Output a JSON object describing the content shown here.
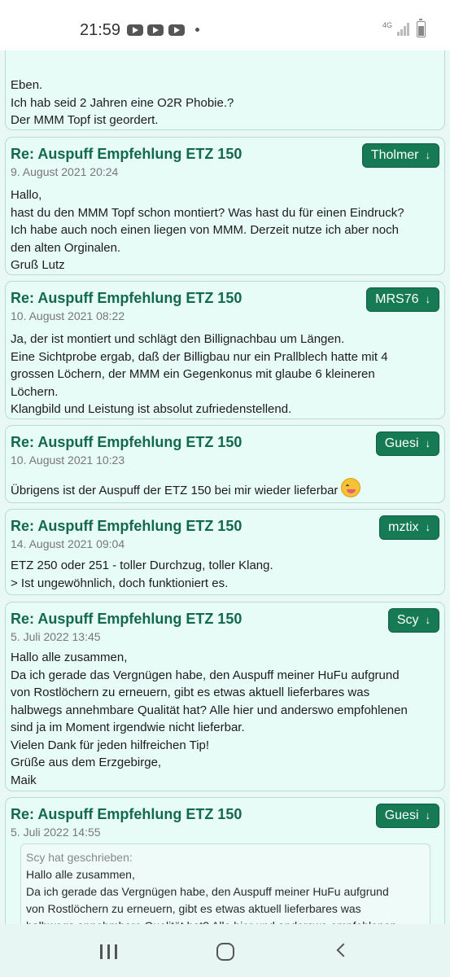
{
  "status": {
    "time": "21:59",
    "network": "4G"
  },
  "posts": [
    {
      "body": [
        "Eben.",
        "Ich hab seid 2 Jahren eine O2R Phobie.?",
        "Der MMM Topf ist geordert."
      ]
    },
    {
      "title": "Re: Auspuff Empfehlung ETZ 150",
      "date": "9. August 2021 20:24",
      "author": "Tholmer",
      "body": [
        "Hallo,",
        "hast du den MMM Topf schon montiert? Was hast du für einen Eindruck?",
        "Ich habe auch noch einen liegen von MMM. Derzeit nutze ich aber noch",
        "den alten Orginalen.",
        "Gruß Lutz"
      ]
    },
    {
      "title": "Re: Auspuff Empfehlung ETZ 150",
      "date": "10. August 2021 08:22",
      "author": "MRS76",
      "body": [
        "Ja, der ist montiert und schlägt den Billignachbau um Längen.",
        "Eine Sichtprobe ergab, daß der Billigbau nur ein Prallblech hatte mit 4",
        "grossen Löchern, der MMM ein Gegenkonus mit glaube 6 kleineren",
        "Löchern.",
        "Klangbild und Leistung ist absolut zufriedenstellend."
      ]
    },
    {
      "title": "Re: Auspuff Empfehlung ETZ 150",
      "date": "10. August 2021 10:23",
      "author": "Guesi",
      "body": [
        "Übrigens ist der Auspuff der ETZ 150 bei mir wieder lieferbar"
      ],
      "emoji": "grinning-face-with-tongue"
    },
    {
      "title": "Re: Auspuff Empfehlung ETZ 150",
      "date": "14. August 2021 09:04",
      "author": "mztix",
      "body": [
        "ETZ 250 oder 251 - toller Durchzug, toller Klang.",
        "> Ist ungewöhnlich, doch funktioniert es."
      ]
    },
    {
      "title": "Re: Auspuff Empfehlung ETZ 150",
      "date": "5. Juli 2022 13:45",
      "author": "Scy",
      "body": [
        "Hallo alle zusammen,",
        "Da ich gerade das Vergnügen habe, den Auspuff meiner HuFu aufgrund",
        "von Rostlöchern zu erneuern, gibt es etwas aktuell lieferbares was",
        "halbwegs annehmbare Qualität hat? Alle hier und anderswo empfohlenen",
        "sind ja im Moment irgendwie nicht lieferbar.",
        "Vielen Dank für jeden hilfreichen Tip!",
        "Grüße aus dem Erzgebirge,",
        "Maik"
      ]
    },
    {
      "title": "Re: Auspuff Empfehlung ETZ 150",
      "date": "5. Juli 2022 14:55",
      "author": "Guesi",
      "quote": {
        "header": "Scy hat geschrieben:",
        "lines": [
          "Hallo alle zusammen,",
          "Da ich gerade das Vergnügen habe, den Auspuff meiner HuFu aufgrund",
          "von Rostlöchern zu erneuern, gibt es etwas aktuell lieferbares was",
          "halbwegs annehmbare Qualität hat? Alle hier und anderswo empfohlenen"
        ]
      }
    }
  ],
  "ui": {
    "author_arrow": "↓"
  },
  "colors": {
    "accent": "#167a55",
    "title": "#136a4a",
    "background": "#e9f8f4"
  }
}
